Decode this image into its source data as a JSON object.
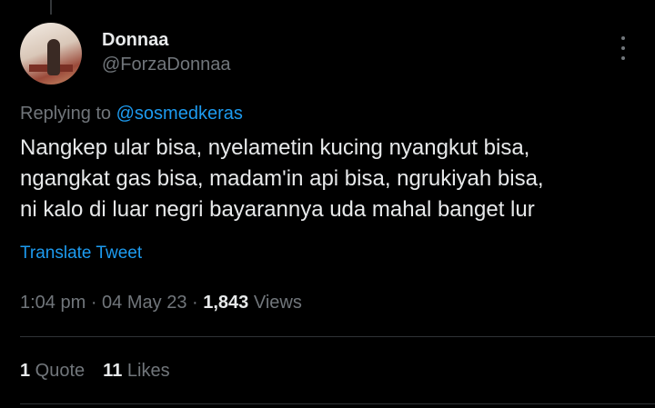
{
  "author": {
    "name": "Donnaa",
    "handle": "@ForzaDonnaa"
  },
  "reply": {
    "prefix": "Replying to ",
    "to": "@sosmedkeras"
  },
  "tweet": {
    "text": "Nangkep ular bisa, nyelametin kucing nyangkut bisa,\nngangkat gas bisa, madam'in api bisa, ngrukiyah bisa,\nni kalo di luar negri bayarannya uda mahal banget lur"
  },
  "translate_label": "Translate Tweet",
  "meta": {
    "time": "1:04 pm",
    "sep1": " · ",
    "date": "04 May 23",
    "sep2": " · ",
    "views_count": "1,843",
    "views_label": " Views"
  },
  "stats": {
    "quotes_count": "1",
    "quotes_label": " Quote",
    "likes_count": "11",
    "likes_label": " Likes"
  },
  "icons": {
    "more": "more-vertical-icon"
  },
  "colors": {
    "background": "#000000",
    "text": "#e7e9ea",
    "secondary": "#71767b",
    "accent": "#1d9bf0"
  }
}
